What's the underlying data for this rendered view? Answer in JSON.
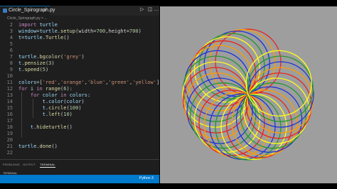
{
  "editor": {
    "tab_label": "Circle_Spirograph.py",
    "tab_close": "×",
    "breadcrumb": "Circle_Spirograph.py > ...",
    "lines": [
      {
        "n": "2",
        "t": "import turtle"
      },
      {
        "n": "3",
        "t": "window=turtle.setup(width=700,height=700)"
      },
      {
        "n": "4",
        "t": "t=turtle.Turtle()"
      },
      {
        "n": "5",
        "t": ""
      },
      {
        "n": "6",
        "t": ""
      },
      {
        "n": "7",
        "t": "turtle.bgcolor('grey')"
      },
      {
        "n": "8",
        "t": "t.pensize(3)"
      },
      {
        "n": "9",
        "t": "t.speed(5)"
      },
      {
        "n": "10",
        "t": ""
      },
      {
        "n": "11",
        "t": "colors=['red','orange','blue','green','yellow']"
      },
      {
        "n": "12",
        "t": "for i in range(6):"
      },
      {
        "n": "13",
        "t": "    for color in colors:"
      },
      {
        "n": "14",
        "t": "        t.color(color)"
      },
      {
        "n": "15",
        "t": "        t.circle(100)"
      },
      {
        "n": "16",
        "t": "        t.left(10)"
      },
      {
        "n": "17",
        "t": ""
      },
      {
        "n": "18",
        "t": "    t.hideturtle()"
      },
      {
        "n": "19",
        "t": ""
      },
      {
        "n": "20",
        "t": ""
      },
      {
        "n": "21",
        "t": "turtle.done()"
      },
      {
        "n": "22",
        "t": ""
      }
    ]
  },
  "panel": {
    "tabs": [
      "PROBLEMS",
      "OUTPUT",
      "TERMINAL"
    ],
    "terminal_label": "TERMINAL"
  },
  "statusbar": {
    "python_label": "Python 3"
  },
  "turtle_window": {
    "background": "#9e9e9e",
    "colors": [
      "red",
      "orange",
      "blue",
      "green",
      "yellow"
    ]
  }
}
